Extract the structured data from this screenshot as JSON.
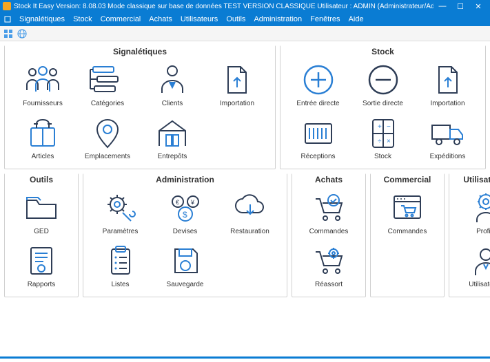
{
  "window": {
    "title": "Stock It Easy Version: 8.08.03  Mode  classique sur base de données TEST VERSION CLASSIQUE Utilisateur : ADMIN (Administrateur/Administrator) - [Menu princi",
    "minimize": "—",
    "maximize": "☐",
    "close": "✕"
  },
  "menu": {
    "signaletiques": "Signalétiques",
    "stock": "Stock",
    "commercial": "Commercial",
    "achats": "Achats",
    "utilisateurs": "Utilisateurs",
    "outils": "Outils",
    "administration": "Administration",
    "fenetres": "Fenêtres",
    "aide": "Aide"
  },
  "panels": {
    "signaletiques": {
      "title": "Signalétiques",
      "fournisseurs": "Fournisseurs",
      "categories": "Catégories",
      "clients": "Clients",
      "importation": "Importation",
      "articles": "Articles",
      "emplacements": "Emplacements",
      "entrepots": "Entrepôts"
    },
    "stock": {
      "title": "Stock",
      "entree": "Entrée directe",
      "sortie": "Sortie directe",
      "importation": "Importation",
      "receptions": "Réceptions",
      "stock": "Stock",
      "expeditions": "Expéditions"
    },
    "outils": {
      "title": "Outils",
      "ged": "GED",
      "rapports": "Rapports"
    },
    "administration": {
      "title": "Administration",
      "parametres": "Paramètres",
      "devises": "Devises",
      "restauration": "Restauration",
      "listes": "Listes",
      "sauvegarde": "Sauvegarde"
    },
    "achats": {
      "title": "Achats",
      "commandes": "Commandes",
      "reassort": "Réassort"
    },
    "commercial": {
      "title": "Commercial",
      "commandes": "Commandes"
    },
    "utilisateurs": {
      "title": "Utilisateurs",
      "profils": "Profils",
      "utilisateurs": "Utilisateurs"
    }
  }
}
